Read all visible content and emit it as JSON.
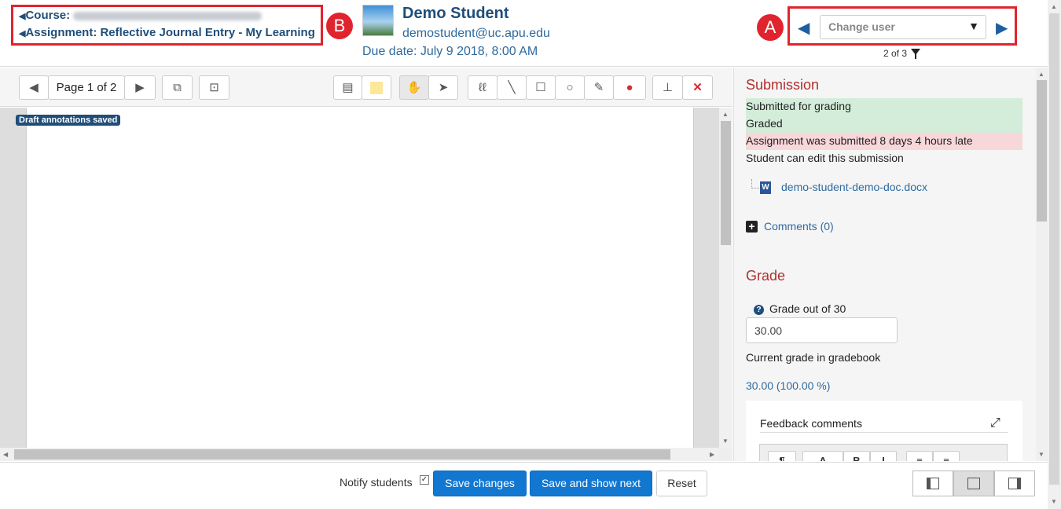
{
  "header": {
    "course_prefix": "Course:",
    "assignment_label": "Assignment: Reflective Journal Entry - My Learning",
    "student_name": "Demo Student",
    "student_email": "demostudent@uc.apu.edu",
    "due_date": "Due date: July 9 2018, 8:00 AM",
    "badge_a": "A",
    "badge_b": "B",
    "change_user_placeholder": "Change user",
    "user_count": "2 of 3",
    "accent_color": "#1f4e79",
    "highlight_color": "#e0242e"
  },
  "toolbar": {
    "page_indicator": "Page 1 of 2",
    "tools": [
      "prev-page-icon",
      "next-page-icon",
      "search-comments-icon",
      "expand-icon",
      "comment-icon",
      "color-swatch-icon",
      "pan-hand-icon",
      "select-pointer-icon",
      "pen-icon",
      "line-icon",
      "rectangle-icon",
      "oval-icon",
      "highlighter-icon",
      "color-drop-icon",
      "stamp-icon",
      "delete-icon"
    ]
  },
  "viewer": {
    "draft_badge": "Draft annotations saved"
  },
  "submission": {
    "title": "Submission",
    "status_grading": "Submitted for grading",
    "status_graded": "Graded",
    "status_late": "Assignment was submitted 8 days 4 hours late",
    "status_edit": "Student can edit this submission",
    "file_name": "demo-student-demo-doc.docx",
    "comments_link": "Comments (0)"
  },
  "grade": {
    "title": "Grade",
    "grade_out_of": "Grade out of 30",
    "grade_value": "30.00",
    "current_grade_label": "Current grade in gradebook",
    "current_grade_value": "30.00 (100.00 %)",
    "feedback_label": "Feedback comments"
  },
  "footer": {
    "notify_label": "Notify students",
    "save_button": "Save changes",
    "save_next_button": "Save and show next",
    "reset_button": "Reset"
  }
}
